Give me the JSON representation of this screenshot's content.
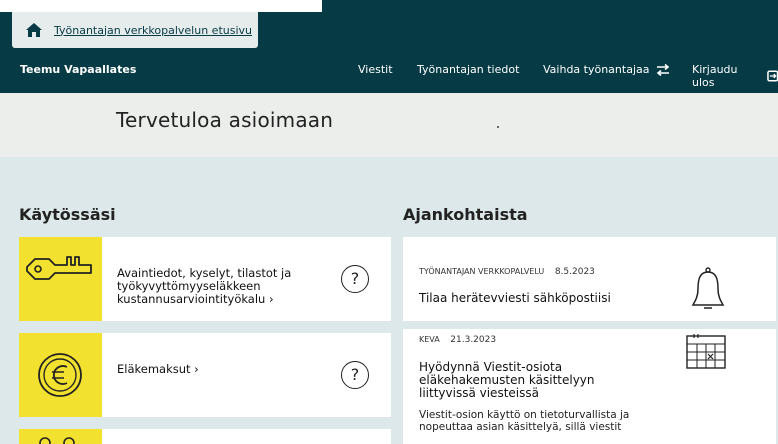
{
  "header": {
    "home_link": "Työnantajan verkkopalvelun etusivu",
    "user_name": "Teemu Vapaallates",
    "nav": [
      {
        "label": "Viestit"
      },
      {
        "label": "Työnantajan tiedot"
      },
      {
        "label": "Vaihda työnantajaa"
      },
      {
        "label": "Kirjaudu ulos"
      }
    ]
  },
  "banner": {
    "title": "Tervetuloa asioimaan"
  },
  "in_use": {
    "heading": "Käytössäsi",
    "cards": [
      {
        "label_lines": [
          "Avaintiedot, kyselyt, tilastot ja",
          "työkyvyttömyyseläkkeen",
          "kustannusarviointityökalu ›"
        ],
        "icon": "key-icon",
        "help": "?"
      },
      {
        "label": "Eläkemaksut ›",
        "icon": "euro-icon",
        "help": "?"
      },
      {
        "icon": "people-icon"
      }
    ]
  },
  "news": {
    "heading": "Ajankohtaista",
    "items": [
      {
        "source": "TYÖNANTAJAN VERKKOPALVELU",
        "date": "8.5.2023",
        "headline": "Tilaa herätevviesti sähköpostiisi",
        "icon": "bell-icon"
      },
      {
        "source": "KEVA",
        "date": "21.3.2023",
        "headline_lines": [
          "Hyödynnä Viestit-osiota",
          "eläkehakemusten käsittelyyn",
          "liittyvissä viesteissä"
        ],
        "body_lines": [
          "Viestit-osion käyttö on tietoturvallista ja",
          "nopeuttaa asian käsittelyä, sillä viestit"
        ],
        "icon": "calendar-icon"
      }
    ]
  },
  "colors": {
    "header_bg": "#063a44",
    "card_yellow": "#f2e12e",
    "page_bg": "#dde8ea"
  }
}
